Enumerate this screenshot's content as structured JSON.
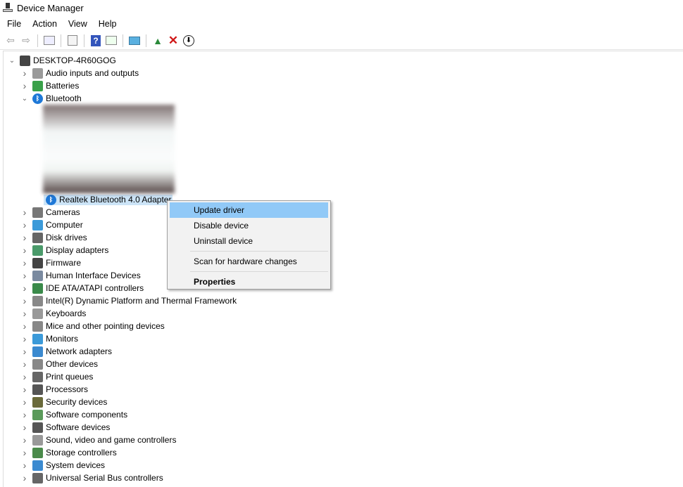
{
  "window": {
    "title": "Device Manager"
  },
  "menu": [
    "File",
    "Action",
    "View",
    "Help"
  ],
  "toolbar": [
    "back-icon",
    "forward-icon",
    "show-hide-console-tree-icon",
    "properties-icon",
    "help-icon",
    "show-action-pane-icon",
    "scan-hardware-icon",
    "update-driver-icon",
    "uninstall-icon",
    "disable-icon"
  ],
  "tree": {
    "root": "DESKTOP-4R60GOG",
    "before": [
      {
        "label": "Audio inputs and outputs",
        "icon": "speaker-icon",
        "color": "#9a9a9a"
      },
      {
        "label": "Batteries",
        "icon": "battery-icon",
        "color": "#3aa14a"
      }
    ],
    "bluetooth": {
      "label": "Bluetooth",
      "child": "Realtek Bluetooth 4.0 Adapter"
    },
    "after": [
      {
        "label": "Cameras",
        "icon": "camera-icon",
        "color": "#777"
      },
      {
        "label": "Computer",
        "icon": "computer-icon",
        "color": "#3b9ad9"
      },
      {
        "label": "Disk drives",
        "icon": "disk-drive-icon",
        "color": "#666"
      },
      {
        "label": "Display adapters",
        "icon": "display-adapter-icon",
        "color": "#4a9a6a"
      },
      {
        "label": "Firmware",
        "icon": "firmware-icon",
        "color": "#444"
      },
      {
        "label": "Human Interface Devices",
        "icon": "hid-icon",
        "color": "#7a8aa0"
      },
      {
        "label": "IDE ATA/ATAPI controllers",
        "icon": "ide-controller-icon",
        "color": "#3a8a4a"
      },
      {
        "label": "Intel(R) Dynamic Platform and Thermal Framework",
        "icon": "device-icon",
        "color": "#888"
      },
      {
        "label": "Keyboards",
        "icon": "keyboard-icon",
        "color": "#999"
      },
      {
        "label": "Mice and other pointing devices",
        "icon": "mouse-icon",
        "color": "#888"
      },
      {
        "label": "Monitors",
        "icon": "monitor-icon",
        "color": "#3b9ad9"
      },
      {
        "label": "Network adapters",
        "icon": "network-adapter-icon",
        "color": "#3b8ad0"
      },
      {
        "label": "Other devices",
        "icon": "other-devices-icon",
        "color": "#888"
      },
      {
        "label": "Print queues",
        "icon": "printer-icon",
        "color": "#666"
      },
      {
        "label": "Processors",
        "icon": "processor-icon",
        "color": "#555"
      },
      {
        "label": "Security devices",
        "icon": "security-device-icon",
        "color": "#6a6a3a"
      },
      {
        "label": "Software components",
        "icon": "software-component-icon",
        "color": "#5a9a5a"
      },
      {
        "label": "Software devices",
        "icon": "software-device-icon",
        "color": "#555"
      },
      {
        "label": "Sound, video and game controllers",
        "icon": "sound-icon",
        "color": "#999"
      },
      {
        "label": "Storage controllers",
        "icon": "storage-controller-icon",
        "color": "#4a8a4a"
      },
      {
        "label": "System devices",
        "icon": "system-device-icon",
        "color": "#3b8ad0"
      },
      {
        "label": "Universal Serial Bus controllers",
        "icon": "usb-icon",
        "color": "#666"
      }
    ]
  },
  "context_menu": {
    "items": [
      "Update driver",
      "Disable device",
      "Uninstall device",
      "Scan for hardware changes",
      "Properties"
    ]
  }
}
